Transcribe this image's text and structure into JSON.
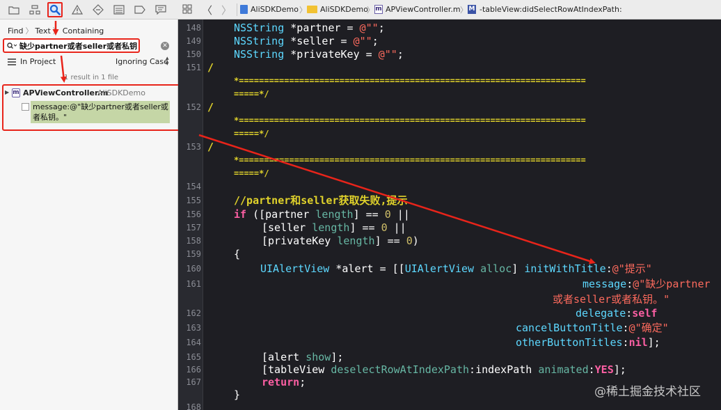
{
  "navigator": {
    "breadcrumb": [
      "Find",
      "Text",
      "Containing"
    ],
    "search_query": "缺少partner或者seller或者私钥",
    "scope": "In Project",
    "case_option": "Ignoring Case",
    "result_summary": "1 result in 1 file",
    "result_file": {
      "name": "APViewController.m",
      "project": "AliSDKDemo",
      "match": "message:@\"缺少partner或者seller或者私钥。\""
    }
  },
  "jumpbar": {
    "crumbs": [
      "AliSDKDemo",
      "AliSDKDemo",
      "APViewController.m",
      "-tableView:didSelectRowAtIndexPath:"
    ]
  },
  "editor": {
    "line_numbers": [
      "148",
      "149",
      "150",
      "151",
      "152",
      "153",
      "154",
      "155",
      "156",
      "157",
      "158",
      "159",
      "160",
      "161",
      "162",
      "163",
      "164",
      "165",
      "166",
      "167",
      "168"
    ],
    "tokens": {
      "nsstring": "NSString",
      "partner_decl": " *partner = ",
      "seller_decl": " *seller = ",
      "private_decl": " *privateKey = ",
      "empty_str": "@\"\"",
      "semi": ";",
      "slash": "/",
      "star_line": "*=====================================================================",
      "star_end": "=====*/",
      "comment": "//partner和seller获取失败,提示",
      "if_kw": "if",
      "if_open": " ([partner ",
      "length": "length",
      "eq_zero": "] == ",
      "zero": "0",
      "or_op": " ||",
      "seller_open": "[seller ",
      "privkey_open": "[privateKey ",
      "close_paren": ")",
      "open_brace": "{",
      "close_brace": "}",
      "uialertview": "UIAlertView",
      "alert_assign": " *alert = [[",
      "alloc": "alloc",
      "bracket_close": "] ",
      "initWithTitle": "initWithTitle",
      "colon": ":",
      "title_str": "@\"提示\"",
      "message": "message",
      "message_str": "@\"缺少partner",
      "message_str2": "或者seller或者私钥。\"",
      "delegate": "delegate",
      "self": "self",
      "cancelButtonTitle": "cancelButtonTitle",
      "cancel_str": "@\"确定\"",
      "otherButtonTitles": "otherButtonTitles",
      "nil": "nil",
      "close_semi": "];",
      "alert_show_open": "[alert ",
      "show": "show",
      "table_open": "[tableView ",
      "deselect": "deselectRowAtIndexPath",
      "indexPath": "indexPath ",
      "animated": "animated",
      "yes": "YES",
      "return_kw": "return"
    }
  },
  "watermark": "@稀土掘金技术社区",
  "colors": {
    "annotation_red": "#e8241a",
    "editor_bg": "#1e1e23",
    "match_highlight": "#c5d6a6"
  }
}
